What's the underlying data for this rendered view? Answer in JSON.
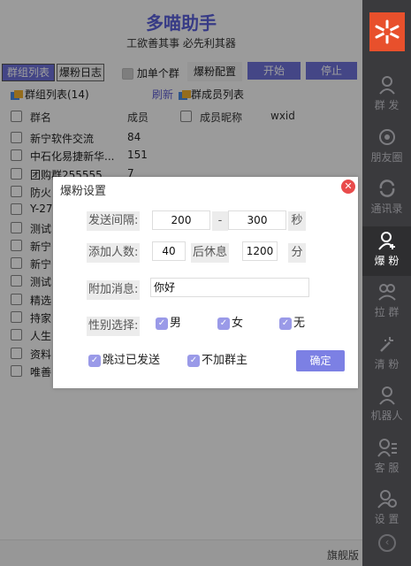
{
  "app": {
    "title": "多喵助手",
    "slogan": "工欲善其事 必先利其器"
  },
  "tabs": {
    "group_list": "群组列表",
    "fan_log": "爆粉日志",
    "add_single": "加单个群",
    "fan_config": "爆粉配置",
    "start": "开始",
    "stop": "停止"
  },
  "list": {
    "title": "群组列表(14)",
    "refresh": "刷新",
    "members_title": "群成员列表",
    "col_name": "群名",
    "col_members": "成员",
    "col_nickname": "成员昵称",
    "col_wxid": "wxid",
    "rows": [
      {
        "name": "新宁软件交流",
        "count": "84"
      },
      {
        "name": "中石化易捷新华...",
        "count": "151"
      },
      {
        "name": "团购群255555",
        "count": "7"
      },
      {
        "name": "防火",
        "count": ""
      },
      {
        "name": "Y-27",
        "count": ""
      },
      {
        "name": "测试",
        "count": ""
      },
      {
        "name": "新宁",
        "count": ""
      },
      {
        "name": "新宁",
        "count": ""
      },
      {
        "name": "测试",
        "count": ""
      },
      {
        "name": "精选",
        "count": ""
      },
      {
        "name": "持家",
        "count": ""
      },
      {
        "name": "人生",
        "count": ""
      },
      {
        "name": "资料",
        "count": ""
      },
      {
        "name": "唯善",
        "count": ""
      }
    ]
  },
  "footer": {
    "edition": "旗舰版"
  },
  "sidebar": {
    "items": [
      {
        "label": "群 发",
        "icon": "group-send-icon"
      },
      {
        "label": "朋友圈",
        "icon": "moments-icon"
      },
      {
        "label": "通讯录",
        "icon": "contacts-icon"
      },
      {
        "label": "爆 粉",
        "icon": "add-user-icon"
      },
      {
        "label": "拉 群",
        "icon": "pull-group-icon"
      },
      {
        "label": "清 粉",
        "icon": "clean-fans-icon"
      },
      {
        "label": "机器人",
        "icon": "robot-icon"
      },
      {
        "label": "客 服",
        "icon": "customer-service-icon"
      },
      {
        "label": "设 置",
        "icon": "settings-icon"
      }
    ],
    "bottom_icon": "collapse-icon"
  },
  "dialog": {
    "title": "爆粉设置",
    "send_interval_label": "发送间隔:",
    "interval_min": "200",
    "interval_sep": "-",
    "interval_max": "300",
    "interval_unit": "秒",
    "add_count_label": "添加人数:",
    "add_count": "40",
    "rest_label": "后休息",
    "rest_value": "1200",
    "rest_unit": "分",
    "message_label": "附加消息:",
    "message_value": "你好",
    "gender_label": "性别选择:",
    "gender_male": "男",
    "gender_female": "女",
    "gender_none": "无",
    "skip_sent": "跳过已发送",
    "skip_group_owner": "不加群主",
    "confirm": "确定"
  },
  "colors": {
    "accent": "#6e72d8",
    "sidebar": "#3a3a3d",
    "logo": "#e8502c",
    "close": "#e94b4b"
  }
}
